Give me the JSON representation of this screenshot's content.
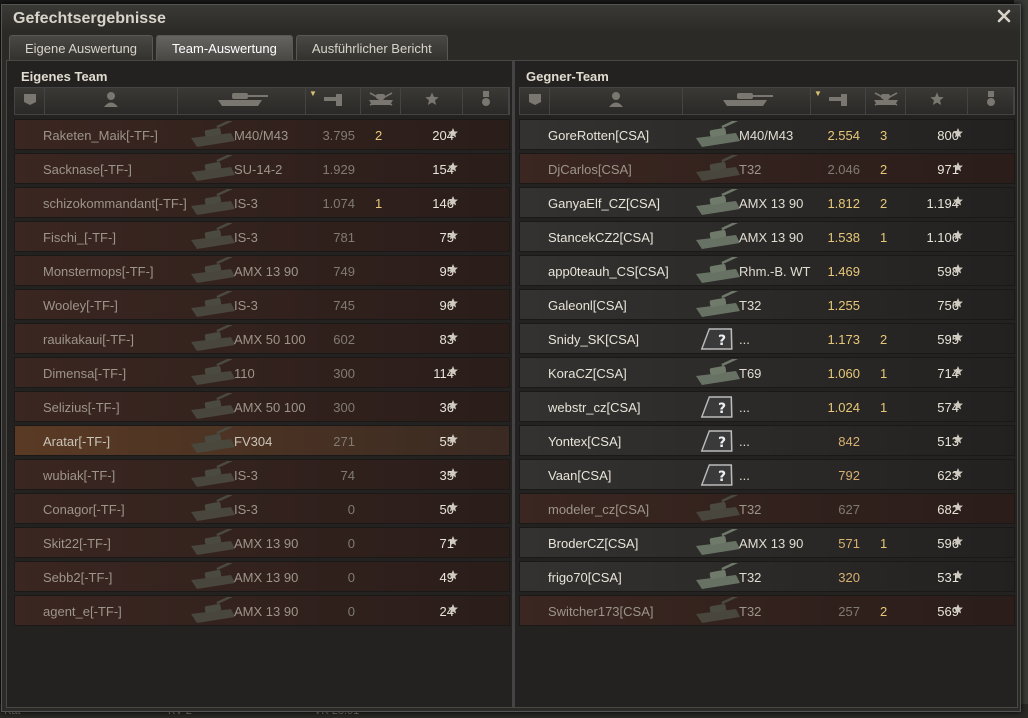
{
  "window": {
    "title": "Gefechtsergebnisse"
  },
  "tabs": [
    {
      "label": "Eigene Auswertung",
      "active": false
    },
    {
      "label": "Team-Auswertung",
      "active": true
    },
    {
      "label": "Ausführlicher Bericht",
      "active": false
    }
  ],
  "background": {
    "left_text": "Kat",
    "mid_text": "KV-2",
    "right_text": "VK 28.01"
  },
  "own_team": {
    "title": "Eigenes Team",
    "rows": [
      {
        "name": "Raketen_Maik[-TF-]",
        "vehicle": "M40/M43",
        "damage": "3.795",
        "kills": "2",
        "xp": "204",
        "state": "dead",
        "dmg_style": "grey"
      },
      {
        "name": "Sacknase[-TF-]",
        "vehicle": "SU-14-2",
        "damage": "1.929",
        "kills": "",
        "xp": "154",
        "state": "dead",
        "dmg_style": "grey"
      },
      {
        "name": "schizokommandant[-TF-]",
        "vehicle": "IS-3",
        "damage": "1.074",
        "kills": "1",
        "xp": "146",
        "state": "dead",
        "dmg_style": "grey"
      },
      {
        "name": "Fischi_[-TF-]",
        "vehicle": "IS-3",
        "damage": "781",
        "kills": "",
        "xp": "75",
        "state": "dead",
        "dmg_style": "grey"
      },
      {
        "name": "Monstermops[-TF-]",
        "vehicle": "AMX 13 90",
        "damage": "749",
        "kills": "",
        "xp": "95",
        "state": "dead",
        "dmg_style": "grey"
      },
      {
        "name": "Wooley[-TF-]",
        "vehicle": "IS-3",
        "damage": "745",
        "kills": "",
        "xp": "96",
        "state": "dead",
        "dmg_style": "grey"
      },
      {
        "name": "rauikakaui[-TF-]",
        "vehicle": "AMX 50 100",
        "damage": "602",
        "kills": "",
        "xp": "83",
        "state": "dead",
        "dmg_style": "grey"
      },
      {
        "name": "Dimensa[-TF-]",
        "vehicle": "110",
        "damage": "300",
        "kills": "",
        "xp": "114",
        "state": "dead",
        "dmg_style": "grey"
      },
      {
        "name": "Selizius[-TF-]",
        "vehicle": "AMX 50 100",
        "damage": "300",
        "kills": "",
        "xp": "36",
        "state": "dead",
        "dmg_style": "grey"
      },
      {
        "name": "Aratar[-TF-]",
        "vehicle": "FV304",
        "damage": "271",
        "kills": "",
        "xp": "55",
        "state": "me",
        "dmg_style": "grey"
      },
      {
        "name": "wubiak[-TF-]",
        "vehicle": "IS-3",
        "damage": "74",
        "kills": "",
        "xp": "35",
        "state": "dead",
        "dmg_style": "grey"
      },
      {
        "name": "Conagor[-TF-]",
        "vehicle": "IS-3",
        "damage": "0",
        "kills": "",
        "xp": "50",
        "state": "dead",
        "dmg_style": "grey"
      },
      {
        "name": "Skit22[-TF-]",
        "vehicle": "AMX 13 90",
        "damage": "0",
        "kills": "",
        "xp": "71",
        "state": "dead",
        "dmg_style": "grey"
      },
      {
        "name": "Sebb2[-TF-]",
        "vehicle": "AMX 13 90",
        "damage": "0",
        "kills": "",
        "xp": "49",
        "state": "dead",
        "dmg_style": "grey"
      },
      {
        "name": "agent_e[-TF-]",
        "vehicle": "AMX 13 90",
        "damage": "0",
        "kills": "",
        "xp": "24",
        "state": "dead",
        "dmg_style": "grey"
      }
    ]
  },
  "enemy_team": {
    "title": "Gegner-Team",
    "rows": [
      {
        "name": "GoreRotten[CSA]",
        "vehicle": "M40/M43",
        "damage": "2.554",
        "kills": "3",
        "xp": "800",
        "state": "alive",
        "dmg_style": "gold",
        "unknown": false
      },
      {
        "name": "DjCarlos[CSA]",
        "vehicle": "T32",
        "damage": "2.046",
        "kills": "2",
        "xp": "971",
        "state": "dead",
        "dmg_style": "grey",
        "unknown": false
      },
      {
        "name": "GanyaElf_CZ[CSA]",
        "vehicle": "AMX 13 90",
        "damage": "1.812",
        "kills": "2",
        "xp": "1.194",
        "state": "alive",
        "dmg_style": "gold",
        "unknown": false
      },
      {
        "name": "StancekCZ2[CSA]",
        "vehicle": "AMX 13 90",
        "damage": "1.538",
        "kills": "1",
        "xp": "1.106",
        "state": "alive",
        "dmg_style": "gold",
        "unknown": false
      },
      {
        "name": "app0teauh_CS[CSA]",
        "vehicle": "Rhm.-B. WT",
        "damage": "1.469",
        "kills": "",
        "xp": "598",
        "state": "alive",
        "dmg_style": "gold",
        "unknown": false
      },
      {
        "name": "Galeonl[CSA]",
        "vehicle": "T32",
        "damage": "1.255",
        "kills": "",
        "xp": "756",
        "state": "alive",
        "dmg_style": "gold",
        "unknown": false
      },
      {
        "name": "Snidy_SK[CSA]",
        "vehicle": "...",
        "damage": "1.173",
        "kills": "2",
        "xp": "595",
        "state": "alive",
        "dmg_style": "gold",
        "unknown": true
      },
      {
        "name": "KoraCZ[CSA]",
        "vehicle": "T69",
        "damage": "1.060",
        "kills": "1",
        "xp": "714",
        "state": "alive",
        "dmg_style": "gold",
        "unknown": false
      },
      {
        "name": "webstr_cz[CSA]",
        "vehicle": "...",
        "damage": "1.024",
        "kills": "1",
        "xp": "574",
        "state": "alive",
        "dmg_style": "gold",
        "unknown": true
      },
      {
        "name": "Yontex[CSA]",
        "vehicle": "...",
        "damage": "842",
        "kills": "",
        "xp": "513",
        "state": "alive",
        "dmg_style": "warm",
        "unknown": true
      },
      {
        "name": "Vaan[CSA]",
        "vehicle": "...",
        "damage": "792",
        "kills": "",
        "xp": "623",
        "state": "alive",
        "dmg_style": "warm",
        "unknown": true
      },
      {
        "name": "modeler_cz[CSA]",
        "vehicle": "T32",
        "damage": "627",
        "kills": "",
        "xp": "682",
        "state": "dead",
        "dmg_style": "grey",
        "unknown": false
      },
      {
        "name": "BroderCZ[CSA]",
        "vehicle": "AMX 13 90",
        "damage": "571",
        "kills": "1",
        "xp": "596",
        "state": "alive",
        "dmg_style": "warm",
        "unknown": false
      },
      {
        "name": "frigo70[CSA]",
        "vehicle": "T32",
        "damage": "320",
        "kills": "",
        "xp": "531",
        "state": "alive",
        "dmg_style": "warm",
        "unknown": false
      },
      {
        "name": "Switcher173[CSA]",
        "vehicle": "T32",
        "damage": "257",
        "kills": "2",
        "xp": "569",
        "state": "dead",
        "dmg_style": "grey",
        "unknown": false
      }
    ]
  },
  "colors": {
    "dead_row": "#3b2621",
    "alive_row": "#343230",
    "self_row": "#5a3a24",
    "kills": "#e8c878"
  },
  "header_icons": [
    "platoon-icon",
    "player-icon",
    "tank-icon",
    "damage-icon",
    "kills-icon",
    "xp-star-icon",
    "medal-icon"
  ]
}
